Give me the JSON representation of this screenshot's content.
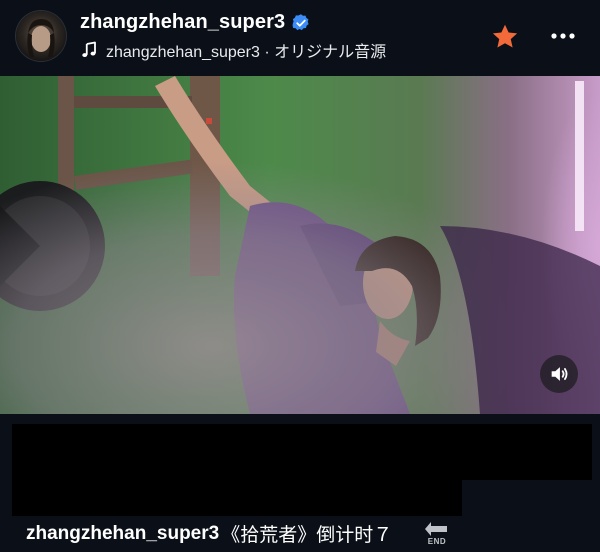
{
  "header": {
    "username": "zhangzhehan_super3",
    "verified": true,
    "audio_line": "zhangzhehan_super3 · オリジナル音源",
    "accent_star_color": "#f26a3a",
    "verified_color": "#3b8cf6"
  },
  "icons": {
    "avatar": "avatar",
    "verified": "verified-badge-icon",
    "music": "music-note-icon",
    "star": "star-icon",
    "more": "more-options-icon",
    "sound": "speaker-icon",
    "end": "end-arrow-icon"
  },
  "caption": {
    "username": "zhangzhehan_super3",
    "text": "《拾荒者》倒计时７",
    "end_label": "END"
  }
}
